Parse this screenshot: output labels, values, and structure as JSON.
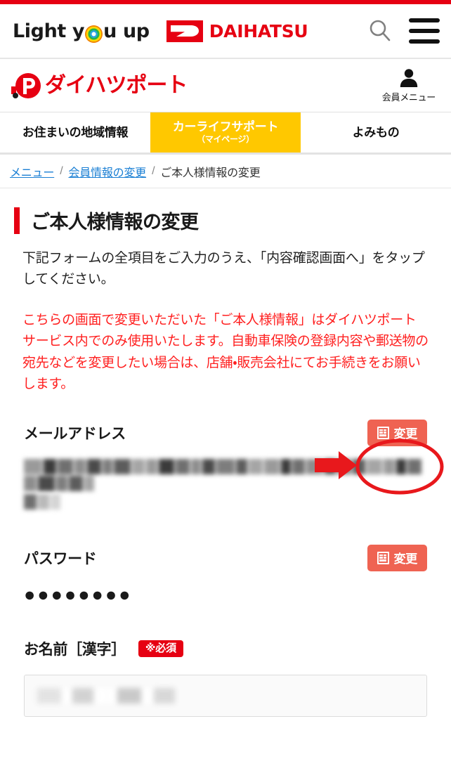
{
  "header": {
    "tagline_before": "Light y",
    "tagline_after": "u up",
    "brand_logo_text": "DAIHATSU",
    "brand_mark_icon": "daihatsu-logo-icon",
    "search_icon": "search-icon",
    "menu_icon": "hamburger-menu-icon",
    "portal_logo_text": "ダイハツポート",
    "portal_mark_icon": "daihatsu-port-truck-icon",
    "member_icon": "person-icon",
    "member_label": "会員メニュー"
  },
  "tabs": [
    {
      "label": "お住まいの地域情報",
      "sub": "",
      "active": false
    },
    {
      "label": "カーライフサポート",
      "sub": "（マイページ）",
      "active": true
    },
    {
      "label": "よみもの",
      "sub": "",
      "active": false
    }
  ],
  "breadcrumb": {
    "items": [
      {
        "label": "メニュー",
        "link": true
      },
      {
        "label": "会員情報の変更",
        "link": true
      },
      {
        "label": "ご本人様情報の変更",
        "link": false
      }
    ],
    "separator": "/"
  },
  "page": {
    "title": "ご本人様情報の変更",
    "lead": "下記フォームの全項目をご入力のうえ、「内容確認画面へ」をタップしてください。",
    "notice": "こちらの画面で変更いただいた「ご本人様情報」はダイハツポートサービス内でのみ使用いたします。自動車保険の登録内容や郵送物の宛先などを変更したい場合は、店舗・販売会社にてお手続きをお願いします。"
  },
  "fields": {
    "email": {
      "label": "メールアドレス",
      "change_label": "変更",
      "change_icon": "form-document-icon",
      "value_masked": true
    },
    "password": {
      "label": "パスワード",
      "change_label": "変更",
      "change_icon": "form-document-icon",
      "value_dots": "●●●●●●●●"
    },
    "name_kanji": {
      "label": "お名前［漢字］",
      "required_badge": "※必須",
      "value_masked": true
    }
  },
  "annotations": {
    "arrow_icon": "red-right-arrow-annotation",
    "ellipse_icon": "red-ellipse-highlight-annotation",
    "color": "#e8181c"
  },
  "colors": {
    "brand_red": "#e60012",
    "tab_yellow": "#ffc800",
    "notice_red": "#ff2020",
    "link_blue": "#1a7fd4",
    "change_button": "#ef6352"
  }
}
